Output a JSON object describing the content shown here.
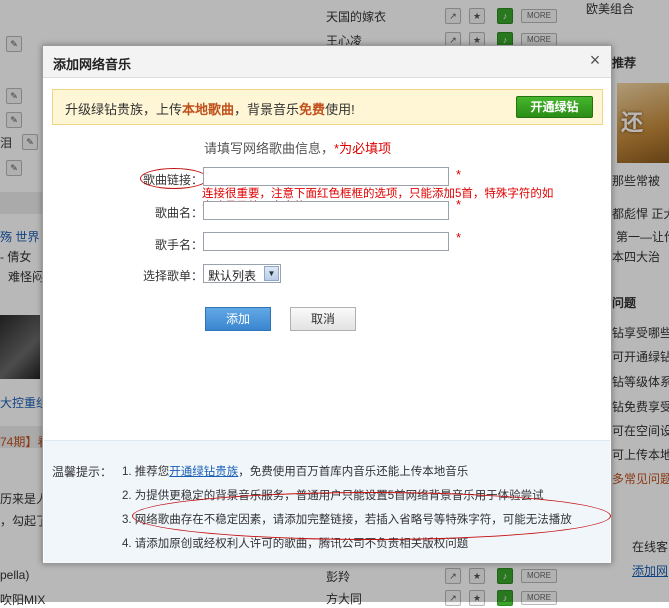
{
  "background": {
    "songs": [
      "天国的嫁衣",
      "王心凌",
      "彭羚",
      "方大同"
    ],
    "more_label": "MORE",
    "left_fragments": [
      "泪",
      "殇 世界",
      "- 倩女",
      "难怪闷",
      "大控重组",
      "74期】看",
      "历来是人",
      "，勾起了",
      "pella)",
      "吹阳MIX"
    ],
    "right_fragments": [
      "欧美组合",
      "推荐",
      "那些常被",
      "都彪悍 正大",
      "第一—让作",
      "本四大治",
      "问题",
      "钻享受哪些",
      "可开通绿钻",
      "钻等级体系",
      "钻免费享受",
      "可在空间设",
      "可上传本地",
      "多常见问题",
      "在线客",
      "添加网"
    ],
    "banner_text": "还"
  },
  "dialog": {
    "title": "添加网络音乐",
    "close_symbol": "×",
    "promo": {
      "text_before": "升级绿钻贵族，上传",
      "highlight1": "本地歌曲",
      "text_middle": "，背景音乐",
      "highlight2": "免费",
      "text_after": "使用!",
      "button_label": "开通绿钻"
    },
    "intro_text": "请填写网络歌曲信息，",
    "intro_required": "*为必填项",
    "fields": {
      "link_label": "歌曲链接：",
      "name_label": "歌曲名：",
      "singer_label": "歌手名：",
      "list_label": "选择歌单：",
      "link_value": "",
      "name_value": "",
      "singer_value": "",
      "required_mark": "*"
    },
    "annotation_note": "连接很重要，注意下面红色框框的选项，只能添加5首，特殊字符的如省略号是放不出来的",
    "select_value": "默认列表",
    "add_button": "添加",
    "cancel_button": "取消",
    "tips_label": "温馨提示：",
    "tips": [
      {
        "prefix": "1. 推荐您",
        "link": "开通绿钻贵族",
        "suffix": "，免费使用百万首库内音乐还能上传本地音乐"
      },
      {
        "text": "2. 为提供更稳定的背景音乐服务，普通用户只能设置5首网络背景音乐用于体验尝试"
      },
      {
        "text": "3. 网络歌曲存在不稳定因素，请添加完整链接，若插入省略号等特殊字符，可能无法播放"
      },
      {
        "text": "4. 请添加原创或经权利人许可的歌曲，腾讯公司不负责相关版权问题"
      }
    ]
  }
}
